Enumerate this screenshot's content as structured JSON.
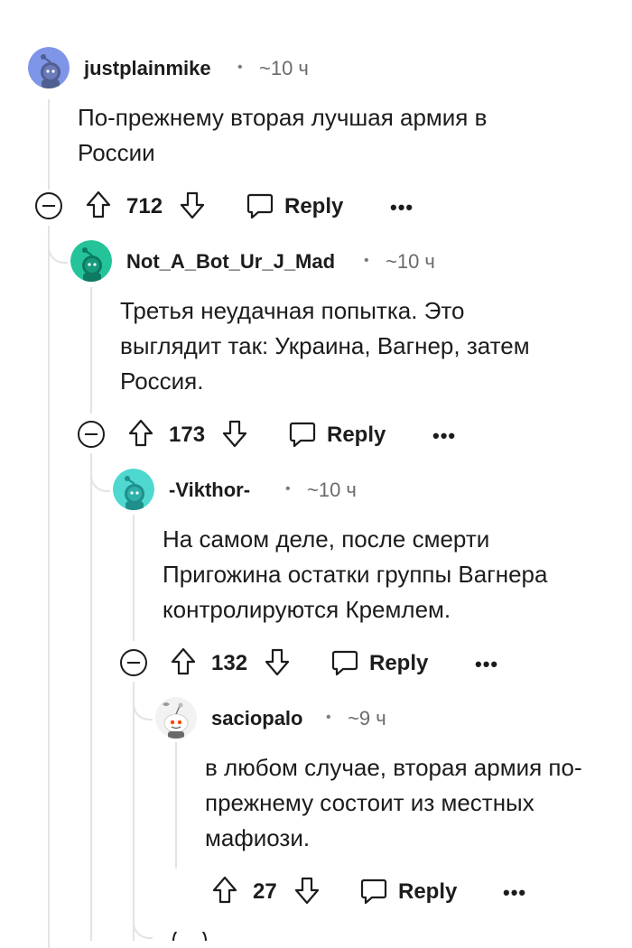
{
  "comments": [
    {
      "username": "justplainmike",
      "time": "~10 ч",
      "body": "По-прежнему вторая лучшая армия в России",
      "votes": "712",
      "reply_label": "Reply",
      "more_label": "•••",
      "avatar_color": "#7e95e8"
    },
    {
      "username": "Not_A_Bot_Ur_J_Mad",
      "time": "~10 ч",
      "body": "Третья неудачная попытка. Это выглядит так: Украина, Вагнер, затем Россия.",
      "votes": "173",
      "reply_label": "Reply",
      "more_label": "•••",
      "avatar_color": "#25c39a"
    },
    {
      "username": "-Vikthor-",
      "time": "~10 ч",
      "body": "На самом деле, после смерти Пригожина остатки группы Вагнера контролируются Кремлем.",
      "votes": "132",
      "reply_label": "Reply",
      "more_label": "•••",
      "avatar_color": "#4fd8d0"
    },
    {
      "username": "saciopalo",
      "time": "~9 ч",
      "body": "в любом случае, вторая армия по-прежнему состоит из местных мафиози.",
      "votes": "27",
      "reply_label": "Reply",
      "more_label": "•••",
      "avatar_color": "#f2f2f2"
    }
  ],
  "icons": {
    "collapse": "minus-circle-icon",
    "upvote": "arrow-up-outline-icon",
    "downvote": "arrow-down-outline-icon",
    "reply": "speech-bubble-icon",
    "more": "ellipsis-icon"
  },
  "colors": {
    "text": "#1c1c1c",
    "meta": "#6b6b6b",
    "thread_line": "#e3e3e3"
  }
}
